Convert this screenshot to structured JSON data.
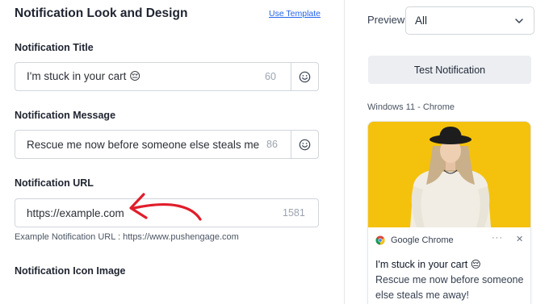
{
  "left": {
    "section_title": "Notification Look and Design",
    "use_template": "Use Template",
    "title_field": {
      "label": "Notification Title",
      "value": "I'm stuck in your cart 😔",
      "counter": "60"
    },
    "message_field": {
      "label": "Notification Message",
      "value": "Rescue me now before someone else steals me away!",
      "counter": "86"
    },
    "url_field": {
      "label": "Notification URL",
      "value": "https://example.com",
      "counter": "1581"
    },
    "url_hint": "Example Notification URL : https://www.pushengage.com",
    "icon_label": "Notification Icon Image"
  },
  "right": {
    "preview_label": "Preview",
    "preview_select": {
      "selected": "All"
    },
    "test_button": "Test Notification",
    "platform": "Windows 11 - Chrome",
    "notification": {
      "browser": "Google Chrome",
      "more": "···",
      "close": "✕",
      "title": "I'm stuck in your cart 😔",
      "message": "Rescue me now before someone else steals me away!"
    }
  },
  "colors": {
    "link": "#2563eb",
    "arrow": "#e11d2a",
    "hero_bg": "#f4c20d",
    "button_bg": "#eceef2"
  },
  "icons": [
    "smiley-icon",
    "chevron-down-icon",
    "chrome-icon",
    "more-icon",
    "close-icon",
    "arrow-annotation"
  ]
}
